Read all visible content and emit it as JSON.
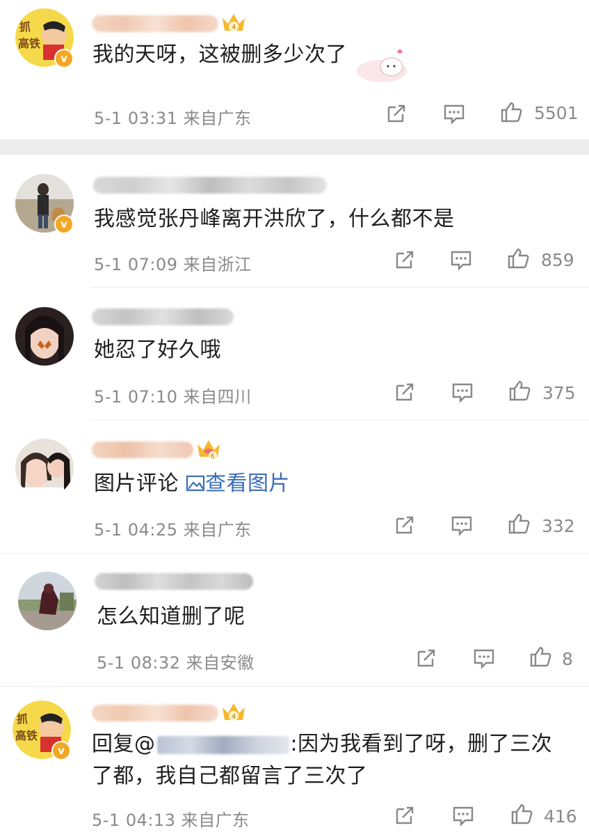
{
  "comments": [
    {
      "text": "我的天呀，这被删多少次了",
      "time": "5-1 03:31",
      "location": "来自广东",
      "likes": "5501",
      "crown_level": "4",
      "avatar_text": "抓高铁"
    },
    {
      "text": "我感觉张丹峰离开洪欣了，什么都不是",
      "time": "5-1 07:09",
      "location": "来自浙江",
      "likes": "859"
    },
    {
      "text": "她忍了好久哦",
      "time": "5-1 07:10",
      "location": "来自四川",
      "likes": "375"
    },
    {
      "text": "图片评论",
      "link_text": "查看图片",
      "time": "5-1 04:25",
      "location": "来自广东",
      "likes": "332",
      "crown_level": "6"
    },
    {
      "text": "怎么知道删了呢",
      "time": "5-1 08:32",
      "location": "来自安徽",
      "likes": "8"
    },
    {
      "reply_prefix": "回复@",
      "text": ":因为我看到了呀，删了三次",
      "text_line2": "了都，我自己都留言了三次了",
      "time": "5-1 04:13",
      "location": "来自广东",
      "likes": "416",
      "crown_level": "4",
      "avatar_text": "抓高铁"
    }
  ],
  "icons": {
    "share": "share-icon",
    "comment": "comment-icon",
    "like": "thumbs-up-icon",
    "verified": "verified-badge-icon",
    "crown": "crown-icon"
  },
  "colors": {
    "separator": "#ececec",
    "meta_text": "#8a8a8a",
    "link": "#3a6db7",
    "badge": "#f5a623"
  }
}
